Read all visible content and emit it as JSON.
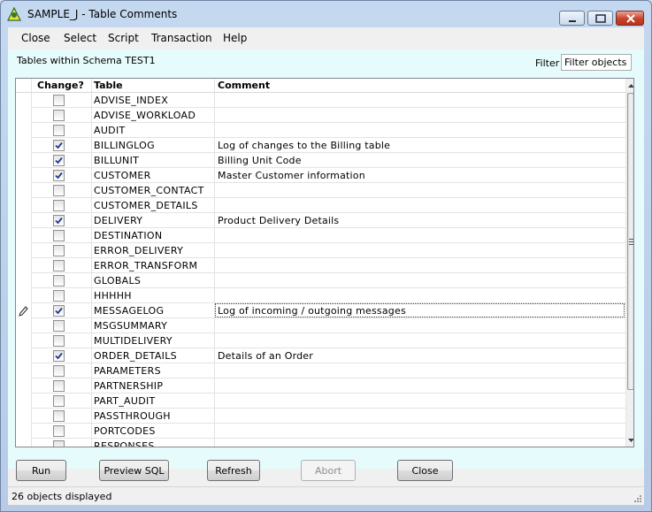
{
  "window": {
    "title": "SAMPLE_J - Table Comments"
  },
  "menu": {
    "items": [
      "Close",
      "Select",
      "Script",
      "Transaction",
      "Help"
    ]
  },
  "panel": {
    "schema_label": "Tables within Schema TEST1"
  },
  "filter": {
    "label": "Filter",
    "value": "Filter objects"
  },
  "grid": {
    "columns": [
      "Change?",
      "Table",
      "Comment"
    ],
    "rows": [
      {
        "table": "ADVISE_INDEX",
        "comment": "",
        "checked": false
      },
      {
        "table": "ADVISE_WORKLOAD",
        "comment": "",
        "checked": false
      },
      {
        "table": "AUDIT",
        "comment": "",
        "checked": false
      },
      {
        "table": "BILLINGLOG",
        "comment": "Log of changes to the Billing table",
        "checked": true
      },
      {
        "table": "BILLUNIT",
        "comment": "Billing Unit Code",
        "checked": true
      },
      {
        "table": "CUSTOMER",
        "comment": "Master Customer information",
        "checked": true
      },
      {
        "table": "CUSTOMER_CONTACT",
        "comment": "",
        "checked": false
      },
      {
        "table": "CUSTOMER_DETAILS",
        "comment": "",
        "checked": false
      },
      {
        "table": "DELIVERY",
        "comment": "Product Delivery Details",
        "checked": true
      },
      {
        "table": "DESTINATION",
        "comment": "",
        "checked": false
      },
      {
        "table": "ERROR_DELIVERY",
        "comment": "",
        "checked": false
      },
      {
        "table": "ERROR_TRANSFORM",
        "comment": "",
        "checked": false
      },
      {
        "table": "GLOBALS",
        "comment": "",
        "checked": false
      },
      {
        "table": "HHHHH",
        "comment": "",
        "checked": false
      },
      {
        "table": "MESSAGELOG",
        "comment": "Log of incoming / outgoing messages",
        "checked": true,
        "editing": true
      },
      {
        "table": "MSGSUMMARY",
        "comment": "",
        "checked": false
      },
      {
        "table": "MULTIDELIVERY",
        "comment": "",
        "checked": false
      },
      {
        "table": "ORDER_DETAILS",
        "comment": "Details of an Order",
        "checked": true
      },
      {
        "table": "PARAMETERS",
        "comment": "",
        "checked": false
      },
      {
        "table": "PARTNERSHIP",
        "comment": "",
        "checked": false
      },
      {
        "table": "PART_AUDIT",
        "comment": "",
        "checked": false
      },
      {
        "table": "PASSTHROUGH",
        "comment": "",
        "checked": false
      },
      {
        "table": "PORTCODES",
        "comment": "",
        "checked": false
      },
      {
        "table": "RESPONSES",
        "comment": "",
        "checked": false
      }
    ]
  },
  "buttons": {
    "run": "Run",
    "preview_sql": "Preview SQL",
    "refresh": "Refresh",
    "abort": "Abort",
    "close": "Close"
  },
  "status": {
    "text": "26 objects displayed"
  },
  "colors": {
    "panel_background": "#e6fbfb",
    "check_color": "#1f3a93",
    "close_button": "#c7432a"
  }
}
